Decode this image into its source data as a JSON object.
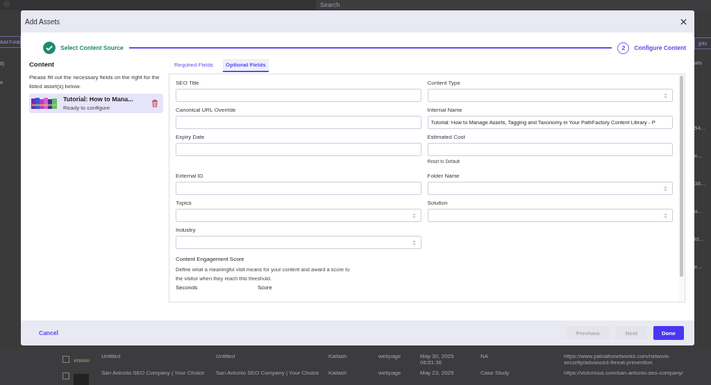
{
  "backdrop": {
    "search_placeholder": "Search",
    "left_texts": [
      "Add Folde",
      "ll)",
      "e"
    ],
    "right_button": "ghts",
    "right_filter": "aits",
    "right_cells": [
      "54...",
      "e...",
      "38...",
      "a...",
      "ld...",
      "e..."
    ],
    "rows": [
      {
        "checked": false,
        "logo_text": "vision",
        "cells": [
          "Untitled",
          "Untitled",
          "Kailash",
          "webpage",
          "May 30, 2025\n06:51:36",
          "NA",
          "https://www.paloaltonetworks.com/network-security/advanced-threat-prevention"
        ]
      },
      {
        "checked": false,
        "cells": [
          "San Antonio SEO Company | Your Choice",
          "San Antonio SEO Company | Your Choice",
          "Kailash",
          "webpage",
          "May 23, 2025",
          "Case Study",
          "https://victorious.com/san-antonio-seo-company/"
        ]
      }
    ]
  },
  "modal": {
    "title": "Add Assets",
    "steps": [
      {
        "label": "Select Content Source",
        "complete": true
      },
      {
        "number": "2",
        "label": "Configure Content",
        "complete": false
      }
    ],
    "sidebar": {
      "heading": "Content",
      "description": "Please fill out the necessary fields on the right for the listed asset(s) below.",
      "assets": [
        {
          "title": "Tutorial: How to Mana...",
          "status": "Ready to configure",
          "selected": true
        }
      ]
    },
    "tabs": [
      {
        "label": "Required Fields",
        "selected": false
      },
      {
        "label": "Optional Fields",
        "selected": true
      }
    ],
    "fields": [
      {
        "label": "SEO Title",
        "kind": "text"
      },
      {
        "label": "Content Type",
        "kind": "select"
      },
      {
        "label": "Canonical URL Override",
        "kind": "text"
      },
      {
        "label": "Internal Name",
        "kind": "text",
        "value": "Tutorial: How to Manage Assets, Tagging and Taxonomy in Your PathFactory Content Library - P"
      },
      {
        "label": "Expiry Date",
        "kind": "text"
      },
      {
        "label": "Estimated Cost",
        "kind": "text",
        "helper": "Reset to Default"
      },
      {
        "label": "External ID",
        "kind": "text"
      },
      {
        "label": "Folder Name",
        "kind": "select"
      },
      {
        "label": "Topics",
        "kind": "select"
      },
      {
        "label": "Solution",
        "kind": "select"
      },
      {
        "label": "Industry",
        "kind": "select"
      }
    ],
    "engagement": {
      "title": "Content Engagement Score",
      "description": "Define what a meaningful visit means for your content and award a score to the visitor when they reach this threshold.",
      "columns": [
        "Seconds",
        "Score"
      ]
    },
    "buttons": [
      {
        "label": "Cancel",
        "kind": "link"
      },
      {
        "label": "Previous",
        "kind": "secondary",
        "disabled": true
      },
      {
        "label": "Next",
        "kind": "secondary",
        "disabled": true
      },
      {
        "label": "Done",
        "kind": "primary"
      }
    ]
  }
}
